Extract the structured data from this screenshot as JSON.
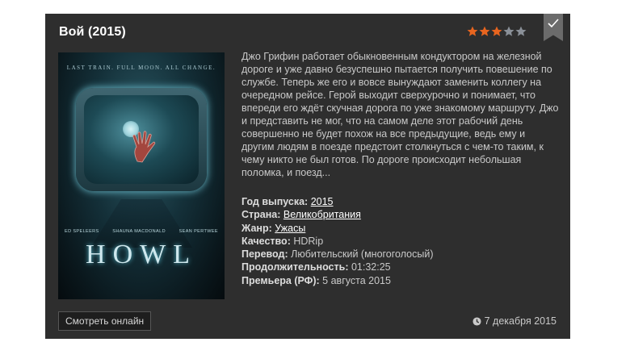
{
  "movie": {
    "title": "Вой (2015)",
    "rating": 3,
    "rating_max": 5,
    "description": "Джо Грифин работает обыкновенным кондуктором на железной дороге и уже давно безуспешно пытается получить повешение по службе. Теперь же его и вовсе вынуждают заменить коллегу на очередном рейсе. Герой выходит сверхурочно и понимает, что впереди его ждёт скучная дорога по уже знакомому маршруту. Джо и представить не мог, что на самом деле этот рабочий день совершенно не будет похож на все предыдущие, ведь ему и другим людям в поезде предстоит столкнуться с чем-то таким, к чему никто не был готов. По дороге происходит небольшая поломка, и поезд...",
    "details": {
      "year_label": "Год выпуска:",
      "year": "2015",
      "country_label": "Страна:",
      "country": "Великобритания",
      "genre_label": "Жанр:",
      "genre": "Ужасы",
      "quality_label": "Качество:",
      "quality": "HDRip",
      "translation_label": "Перевод:",
      "translation": "Любительский (многоголосый)",
      "duration_label": "Продолжительность:",
      "duration": "01:32:25",
      "premiere_label": "Премьера (РФ):",
      "premiere": "5 августа 2015"
    },
    "poster": {
      "tagline": "LAST TRAIN. FULL MOON. ALL CHANGE.",
      "cast": [
        "ED SPELEERS",
        "SHAUNA MACDONALD",
        "SEAN PERTWEE"
      ],
      "logo": "HOWL"
    },
    "watch_button": "Смотреть онлайн",
    "posted_date": "7 декабря 2015"
  },
  "colors": {
    "card_bg": "#2e2e2e",
    "star_filled": "#e8651f",
    "star_empty": "#8a9098",
    "corner_bg": "#6b6b6b"
  },
  "icons": {
    "corner": "checkmark-icon",
    "date": "clock-icon"
  }
}
